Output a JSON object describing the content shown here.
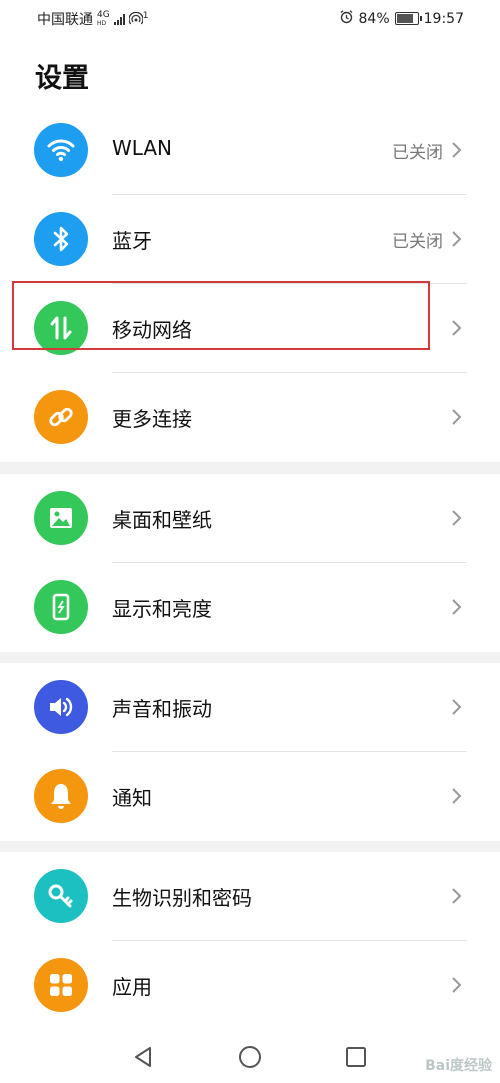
{
  "status_bar": {
    "carrier": "中国联通",
    "network_type": "4G",
    "hd_text": "HD",
    "hotspot_count": "1",
    "battery": "84%",
    "time": "19:57"
  },
  "page": {
    "title": "设置"
  },
  "groups": [
    {
      "items": [
        {
          "label": "WLAN",
          "value": "已关闭",
          "icon": "wifi-icon",
          "color": "#1e9ef0"
        },
        {
          "label": "蓝牙",
          "value": "已关闭",
          "icon": "bluetooth-icon",
          "color": "#1e9ef0"
        },
        {
          "label": "移动网络",
          "value": "",
          "icon": "mobile-data-icon",
          "color": "#34c759"
        },
        {
          "label": "更多连接",
          "value": "",
          "icon": "link-icon",
          "color": "#f5960f"
        }
      ]
    },
    {
      "items": [
        {
          "label": "桌面和壁纸",
          "value": "",
          "icon": "wallpaper-icon",
          "color": "#34c759"
        },
        {
          "label": "显示和亮度",
          "value": "",
          "icon": "display-icon",
          "color": "#34c759"
        }
      ]
    },
    {
      "items": [
        {
          "label": "声音和振动",
          "value": "",
          "icon": "sound-icon",
          "color": "#3d5ae0"
        },
        {
          "label": "通知",
          "value": "",
          "icon": "notification-icon",
          "color": "#f5960f"
        }
      ]
    },
    {
      "items": [
        {
          "label": "生物识别和密码",
          "value": "",
          "icon": "key-icon",
          "color": "#1cc0c0"
        },
        {
          "label": "应用",
          "value": "",
          "icon": "apps-icon",
          "color": "#f5960f"
        }
      ]
    }
  ],
  "watermark": "Bai度经验"
}
